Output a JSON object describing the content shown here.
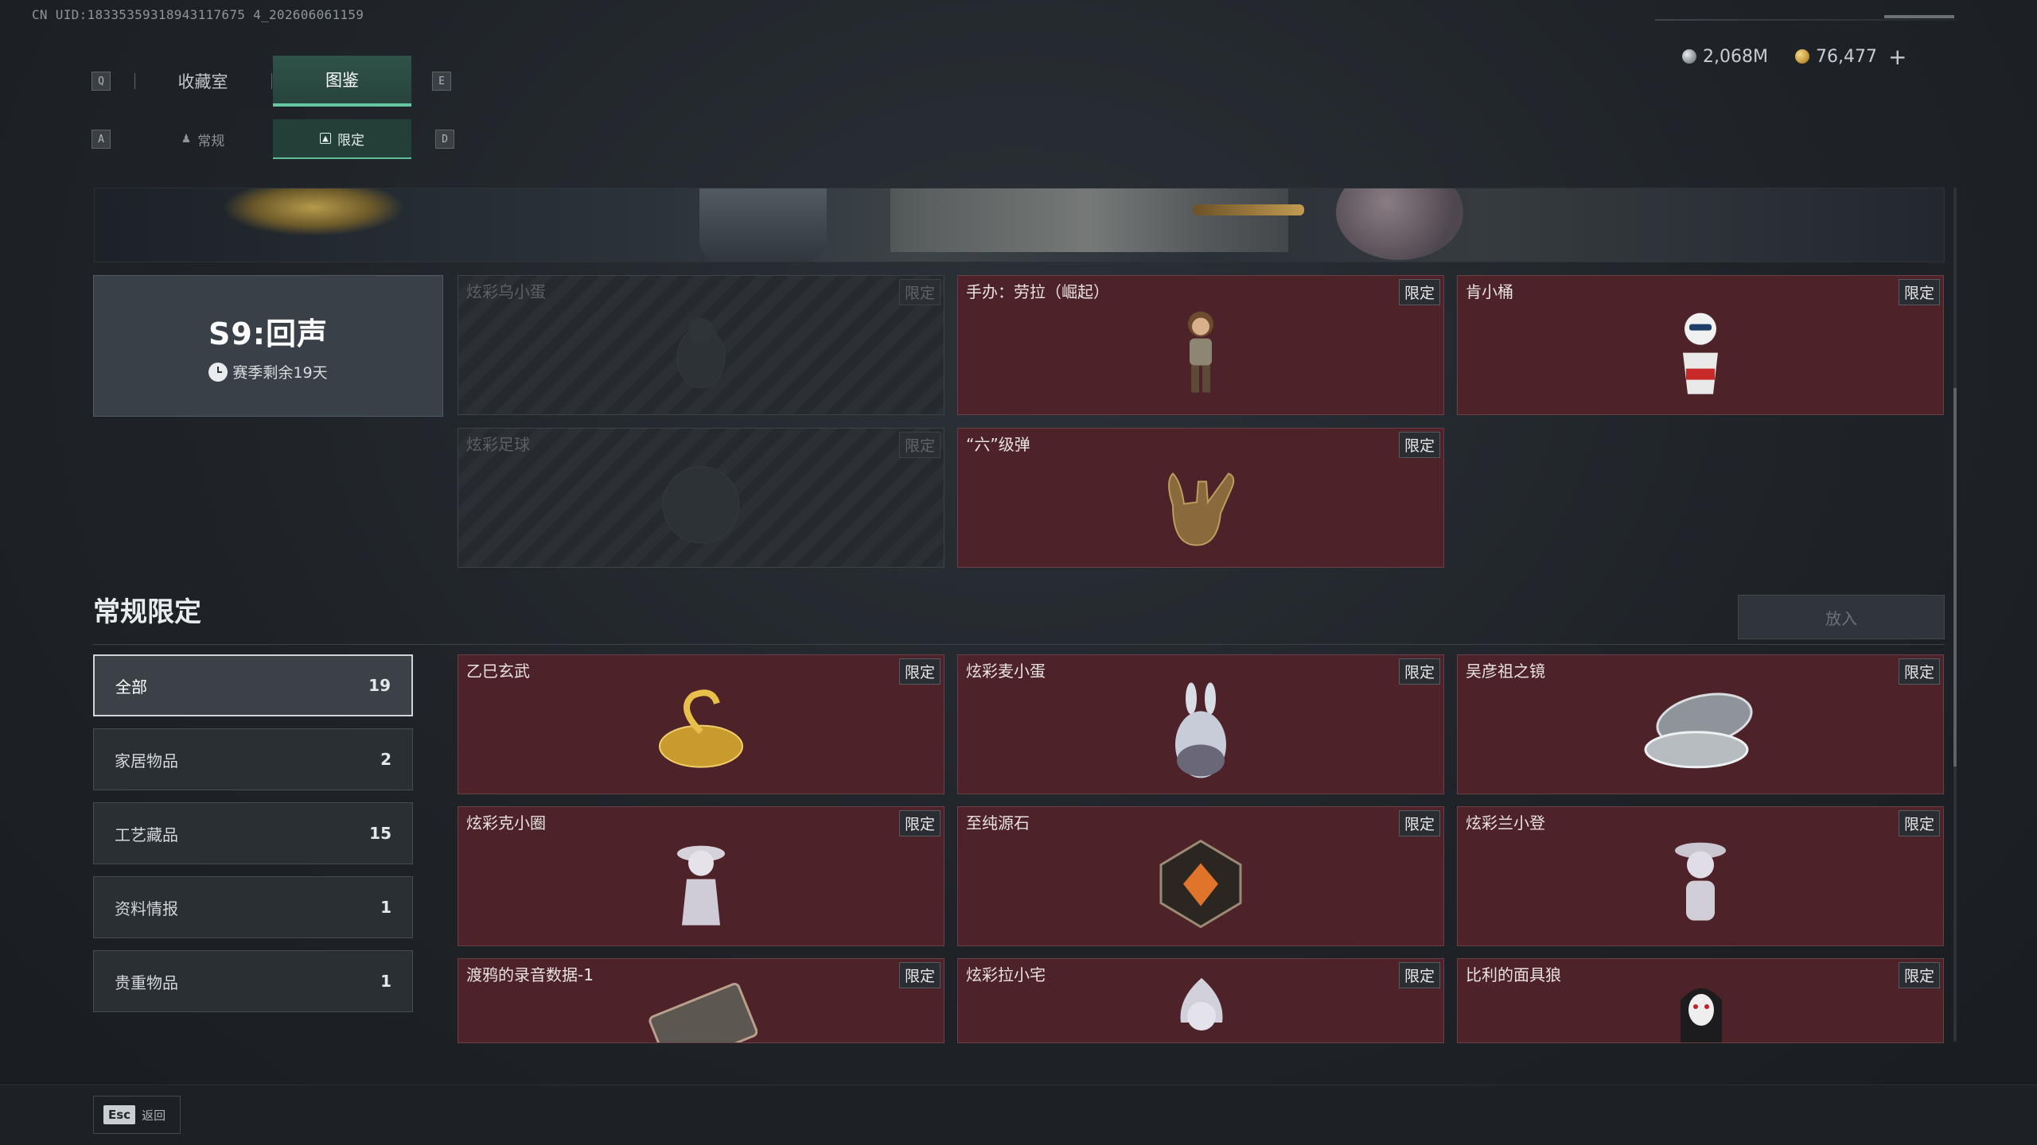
{
  "uid_text": "CN UID:18335359318943117675 4_202606061159",
  "currency": {
    "silver": "2,068M",
    "gold": "76,477",
    "plus": "+"
  },
  "keys": {
    "q": "Q",
    "e": "E",
    "a": "A",
    "d": "D"
  },
  "tabs": {
    "main": [
      {
        "label": "收藏室"
      },
      {
        "label": "图鉴"
      }
    ],
    "sub": [
      {
        "label": "常规"
      },
      {
        "label": "限定"
      }
    ]
  },
  "season": {
    "title": "S9:回声",
    "remaining": "赛季剩余19天"
  },
  "season_items": [
    {
      "name": "炫彩乌小蛋",
      "badge": "限定"
    },
    {
      "name": "手办：劳拉（崛起）",
      "badge": "限定"
    },
    {
      "name": "肯小桶",
      "badge": "限定"
    },
    {
      "name": "炫彩足球",
      "badge": "限定"
    },
    {
      "name": "“六”级弹",
      "badge": "限定"
    }
  ],
  "section": {
    "title": "常规限定",
    "place_button": "放入"
  },
  "categories": [
    {
      "label": "全部",
      "count": "19"
    },
    {
      "label": "家居物品",
      "count": "2"
    },
    {
      "label": "工艺藏品",
      "count": "15"
    },
    {
      "label": "资料情报",
      "count": "1"
    },
    {
      "label": "贵重物品",
      "count": "1"
    }
  ],
  "regular_items": [
    {
      "name": "乙巳玄武",
      "badge": "限定"
    },
    {
      "name": "炫彩麦小蛋",
      "badge": "限定"
    },
    {
      "name": "吴彦祖之镜",
      "badge": "限定"
    },
    {
      "name": "炫彩克小圈",
      "badge": "限定"
    },
    {
      "name": "至纯源石",
      "badge": "限定"
    },
    {
      "name": "炫彩兰小登",
      "badge": "限定"
    },
    {
      "name": "渡鸦的录音数据-1",
      "badge": "限定"
    },
    {
      "name": "炫彩拉小宅",
      "badge": "限定"
    },
    {
      "name": "比利的面具狼",
      "badge": "限定"
    }
  ],
  "footer": {
    "esc_key": "Esc",
    "esc_label": "返回"
  }
}
